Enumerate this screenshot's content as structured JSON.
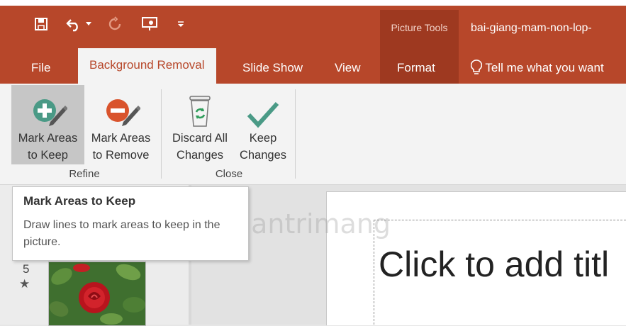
{
  "quick_access": {
    "icons": [
      "save-icon",
      "undo-icon",
      "dropdown-arrow-icon",
      "redo-icon",
      "present-icon",
      "customize-icon"
    ]
  },
  "title_bar": {
    "contextual_group": "Picture Tools",
    "document_title": "bai-giang-mam-non-lop-"
  },
  "tabs": [
    {
      "label": "File",
      "active": false
    },
    {
      "label": "Background Removal",
      "active": true
    },
    {
      "label": "Slide Show",
      "active": false
    },
    {
      "label": "View",
      "active": false
    },
    {
      "label": "Format",
      "active": false
    },
    {
      "label": "Tell me what you want",
      "active": false
    }
  ],
  "ribbon": {
    "refine": {
      "label": "Refine",
      "mark_keep": {
        "line1": "Mark Areas",
        "line2": "to Keep",
        "icon": "mark-areas-to-keep-icon"
      },
      "mark_remove": {
        "line1": "Mark Areas",
        "line2": "to Remove",
        "icon": "mark-areas-to-remove-icon"
      }
    },
    "close": {
      "label": "Close",
      "discard": {
        "line1": "Discard All",
        "line2": "Changes",
        "icon": "recycle-bin-icon"
      },
      "keep": {
        "line1": "Keep",
        "line2": "Changes",
        "icon": "checkmark-icon"
      }
    }
  },
  "tooltip": {
    "title": "Mark Areas to Keep",
    "description": "Draw lines to mark areas to keep in the picture."
  },
  "slides_pane": {
    "slide_number": "5",
    "transition_marker": "★"
  },
  "slide": {
    "placeholder": "Click to add titl"
  },
  "watermark": {
    "text": "uantrimang"
  },
  "colors": {
    "accent": "#b7472a",
    "contextual_band": "#9e3920",
    "keep_green": "#4a9a86",
    "remove_red": "#d9532c"
  }
}
